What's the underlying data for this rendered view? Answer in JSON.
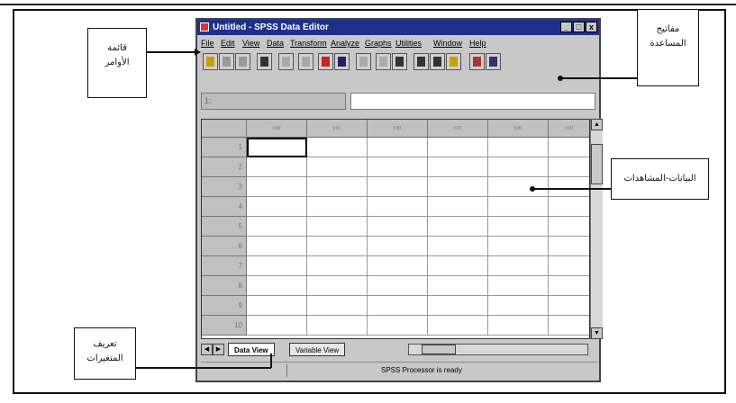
{
  "window": {
    "title": "Untitled - SPSS Data Editor",
    "min_label": "_",
    "max_label": "□",
    "close_label": "x"
  },
  "menu": [
    "File",
    "Edit",
    "View",
    "Data",
    "Transform",
    "Analyze",
    "Graphs",
    "Utilities",
    "Window",
    "Help"
  ],
  "toolbar_icons": [
    "open-icon",
    "save-icon",
    "print-icon",
    "dialog-recall-icon",
    "undo-icon",
    "redo-icon",
    "goto-chart-icon",
    "goto-case-icon",
    "variables-icon",
    "find-icon",
    "insert-case-icon",
    "insert-variable-icon",
    "split-file-icon",
    "weight-cases-icon",
    "select-cases-icon",
    "value-labels-icon",
    "use-sets-icon"
  ],
  "cell_reference": "1:",
  "grid": {
    "column_header": "var",
    "rows": [
      "1",
      "2",
      "3",
      "4",
      "5",
      "6",
      "7",
      "8",
      "9",
      "10"
    ]
  },
  "tabs": [
    "Data View",
    "Variable View"
  ],
  "status_text": "SPSS Processor is ready",
  "callouts": {
    "menu_bar": [
      "قائمة",
      "الأوامر"
    ],
    "toolbar": [
      "مفاتيح",
      "المساعدة"
    ],
    "data": "البيانات-المشاهدات",
    "variables": [
      "تعريف",
      "المتغيرات"
    ]
  }
}
